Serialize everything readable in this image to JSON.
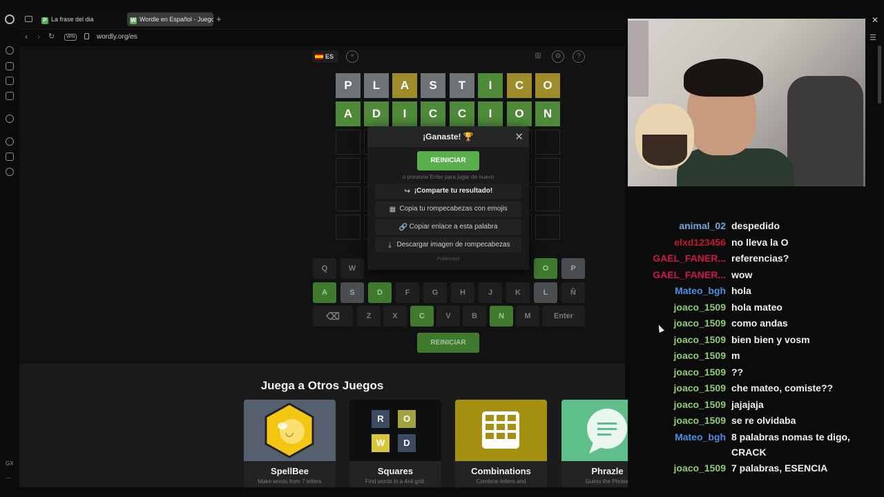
{
  "browser": {
    "tabs": [
      {
        "favicon": "P",
        "label": "La frase del dia"
      },
      {
        "favicon": "W",
        "label": "Wordle en Español - Juego"
      }
    ],
    "new_tab": "+",
    "vpn_label": "VPN",
    "url": "wordly.org/es",
    "sidebar_bottom_label": "GX",
    "sidebar_more": "···"
  },
  "game": {
    "language": "ES",
    "board": [
      [
        {
          "l": "P",
          "s": "gray"
        },
        {
          "l": "L",
          "s": "gray"
        },
        {
          "l": "A",
          "s": "yellow"
        },
        {
          "l": "S",
          "s": "gray"
        },
        {
          "l": "T",
          "s": "gray"
        },
        {
          "l": "I",
          "s": "green"
        },
        {
          "l": "C",
          "s": "yellow"
        },
        {
          "l": "O",
          "s": "yellow"
        }
      ],
      [
        {
          "l": "A",
          "s": "green"
        },
        {
          "l": "D",
          "s": "green"
        },
        {
          "l": "I",
          "s": "green"
        },
        {
          "l": "C",
          "s": "green"
        },
        {
          "l": "C",
          "s": "green"
        },
        {
          "l": "I",
          "s": "green"
        },
        {
          "l": "O",
          "s": "green"
        },
        {
          "l": "N",
          "s": "green"
        }
      ]
    ],
    "keyboard": {
      "row1": [
        {
          "k": "Q",
          "s": ""
        },
        {
          "k": "W",
          "s": ""
        },
        {
          "k": "O",
          "s": "green"
        },
        {
          "k": "P",
          "s": "gray"
        }
      ],
      "row2": [
        {
          "k": "A",
          "s": "green"
        },
        {
          "k": "S",
          "s": "gray"
        },
        {
          "k": "D",
          "s": "green"
        },
        {
          "k": "F",
          "s": ""
        },
        {
          "k": "G",
          "s": ""
        },
        {
          "k": "H",
          "s": ""
        },
        {
          "k": "J",
          "s": ""
        },
        {
          "k": "K",
          "s": ""
        },
        {
          "k": "L",
          "s": "gray"
        },
        {
          "k": "Ñ",
          "s": ""
        }
      ],
      "row3": [
        {
          "k": "Z",
          "s": ""
        },
        {
          "k": "X",
          "s": ""
        },
        {
          "k": "C",
          "s": "green"
        },
        {
          "k": "V",
          "s": ""
        },
        {
          "k": "B",
          "s": ""
        },
        {
          "k": "N",
          "s": "green"
        },
        {
          "k": "M",
          "s": ""
        }
      ],
      "enter": "Enter"
    },
    "restart_label": "REINICIAR"
  },
  "modal": {
    "title": "¡Ganaste! 🏆",
    "close": "✕",
    "restart_label": "REINICIAR",
    "hint": "o presione Enter para jugar de nuevo",
    "share": "¡Comparte tu resultado!",
    "copy_emojis": "Copia tu rompecabezas con emojis",
    "copy_link": "Copiar enlace a esta palabra",
    "download": "Descargar imagen de rompecabezas",
    "ad": "Publicidad"
  },
  "other_games": {
    "title": "Juega a Otros Juegos",
    "cards": [
      {
        "name": "SpellBee",
        "desc": "Make words from 7 letters"
      },
      {
        "name": "Squares",
        "desc": "Find words in a 4x4 grid."
      },
      {
        "name": "Combinations",
        "desc": "Combine letters and"
      },
      {
        "name": "Phrazle",
        "desc": "Guess the Phrase"
      }
    ],
    "squares_letters": [
      "R",
      "O",
      "W",
      "D"
    ]
  },
  "chat": [
    {
      "user": "animal_02",
      "text": "despedido",
      "color": "#6fa8dc"
    },
    {
      "user": "elxd123456",
      "text": "no lleva la O",
      "color": "#c2183a"
    },
    {
      "user": "GAEL_FANER...",
      "text": "referencias?",
      "color": "#d1164a"
    },
    {
      "user": "GAEL_FANER...",
      "text": "wow",
      "color": "#d1164a"
    },
    {
      "user": "Mateo_bgh",
      "text": "hola",
      "color": "#4a90e2"
    },
    {
      "user": "joaco_1509",
      "text": "hola mateo",
      "color": "#8fce70"
    },
    {
      "user": "joaco_1509",
      "text": "como andas",
      "color": "#8fce70"
    },
    {
      "user": "joaco_1509",
      "text": "bien bien y vosm",
      "color": "#8fce70"
    },
    {
      "user": "joaco_1509",
      "text": "m",
      "color": "#8fce70"
    },
    {
      "user": "joaco_1509",
      "text": "??",
      "color": "#8fce70"
    },
    {
      "user": "joaco_1509",
      "text": "che mateo, comiste??",
      "color": "#8fce70"
    },
    {
      "user": "joaco_1509",
      "text": "jajajaja",
      "color": "#8fce70"
    },
    {
      "user": "joaco_1509",
      "text": "se re olvidaba",
      "color": "#8fce70"
    },
    {
      "user": "Mateo_bgh",
      "text": "8 palabras nomas te digo, CRACK",
      "color": "#4a90e2"
    },
    {
      "user": "joaco_1509",
      "text": "7 palabras, ESENCIA",
      "color": "#8fce70"
    }
  ]
}
